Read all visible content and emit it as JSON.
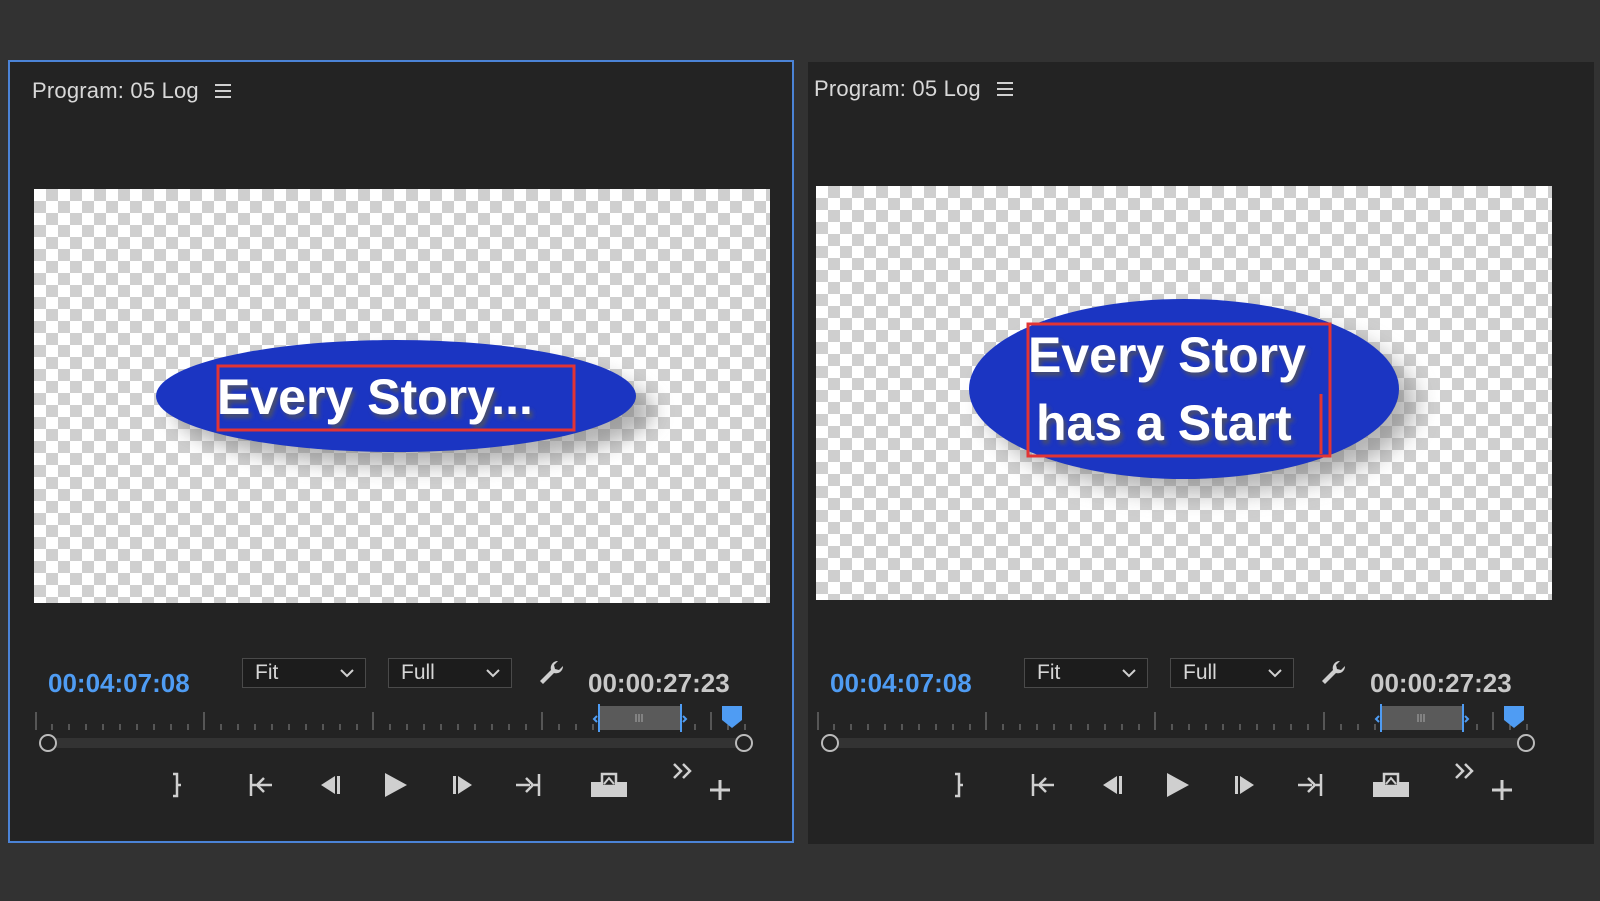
{
  "monitors": [
    {
      "title": "Program: 05 Log",
      "timecode_current": "00:04:07:08",
      "timecode_duration": "00:00:27:23",
      "zoom": "Fit",
      "resolution": "Full",
      "title_text_lines": [
        "Every Story..."
      ]
    },
    {
      "title": "Program: 05 Log",
      "timecode_current": "00:04:07:08",
      "timecode_duration": "00:00:27:23",
      "zoom": "Fit",
      "resolution": "Full",
      "title_text_lines": [
        "Every Story",
        "has a Start"
      ]
    }
  ],
  "colors": {
    "accent": "#4f9cf3",
    "ellipse": "#1b35c2",
    "text_box": "#e23434",
    "panel_border": "#4b83d6"
  },
  "icons": {
    "menu": "hamburger-icon",
    "settings": "wrench-icon",
    "controls": [
      "mark-out-icon",
      "go-to-in-icon",
      "step-back-icon",
      "play-icon",
      "step-forward-icon",
      "go-to-out-icon",
      "export-frame-icon",
      "more-controls-icon",
      "add-button-icon"
    ]
  }
}
